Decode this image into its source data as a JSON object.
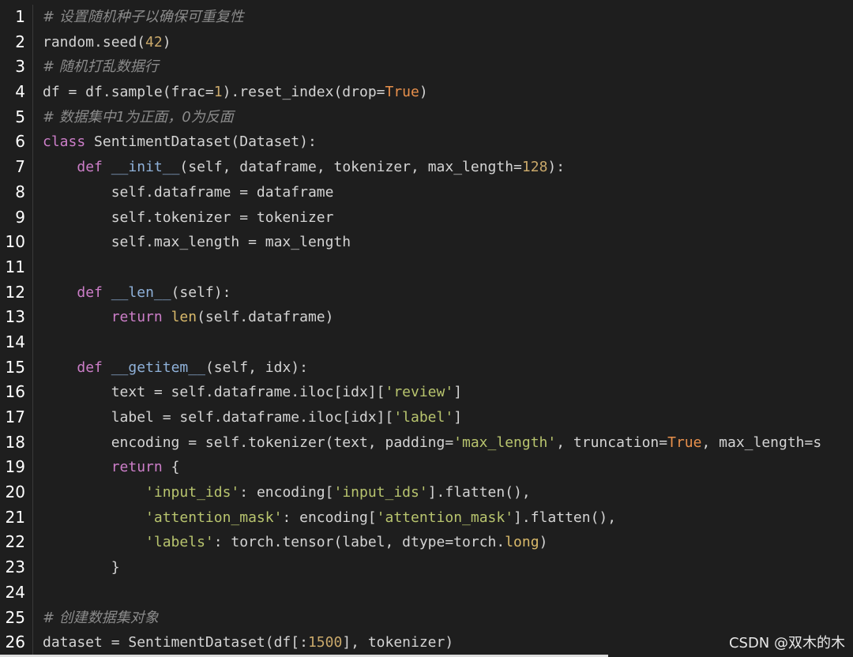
{
  "editor": {
    "lines": [
      {
        "n": "1",
        "tokens": [
          {
            "t": "# 设置随机种子以确保可重复性",
            "c": "comment"
          }
        ]
      },
      {
        "n": "2",
        "tokens": [
          {
            "t": "random.seed(",
            "c": "plain"
          },
          {
            "t": "42",
            "c": "number"
          },
          {
            "t": ")",
            "c": "plain"
          }
        ]
      },
      {
        "n": "3",
        "tokens": [
          {
            "t": "# 随机打乱数据行",
            "c": "comment"
          }
        ]
      },
      {
        "n": "4",
        "tokens": [
          {
            "t": "df = df.sample(frac=",
            "c": "plain"
          },
          {
            "t": "1",
            "c": "number"
          },
          {
            "t": ").reset_index(drop=",
            "c": "plain"
          },
          {
            "t": "True",
            "c": "bool"
          },
          {
            "t": ")",
            "c": "plain"
          }
        ]
      },
      {
        "n": "5",
        "tokens": [
          {
            "t": "# 数据集中1为正面，0为反面",
            "c": "comment"
          }
        ]
      },
      {
        "n": "6",
        "tokens": [
          {
            "t": "class",
            "c": "keyword"
          },
          {
            "t": " SentimentDataset(Dataset):",
            "c": "plain"
          }
        ]
      },
      {
        "n": "7",
        "tokens": [
          {
            "t": "    ",
            "c": "plain"
          },
          {
            "t": "def",
            "c": "keyword"
          },
          {
            "t": " ",
            "c": "plain"
          },
          {
            "t": "__init__",
            "c": "dunder"
          },
          {
            "t": "(self, dataframe, tokenizer, max_length=",
            "c": "plain"
          },
          {
            "t": "128",
            "c": "number"
          },
          {
            "t": "):",
            "c": "plain"
          }
        ]
      },
      {
        "n": "8",
        "tokens": [
          {
            "t": "        self.dataframe = dataframe",
            "c": "plain"
          }
        ]
      },
      {
        "n": "9",
        "tokens": [
          {
            "t": "        self.tokenizer = tokenizer",
            "c": "plain"
          }
        ]
      },
      {
        "n": "10",
        "tokens": [
          {
            "t": "        self.max_length = max_length",
            "c": "plain"
          }
        ]
      },
      {
        "n": "11",
        "tokens": []
      },
      {
        "n": "12",
        "tokens": [
          {
            "t": "    ",
            "c": "plain"
          },
          {
            "t": "def",
            "c": "keyword"
          },
          {
            "t": " ",
            "c": "plain"
          },
          {
            "t": "__len__",
            "c": "dunder"
          },
          {
            "t": "(self):",
            "c": "plain"
          }
        ]
      },
      {
        "n": "13",
        "tokens": [
          {
            "t": "        ",
            "c": "plain"
          },
          {
            "t": "return",
            "c": "keyword"
          },
          {
            "t": " ",
            "c": "plain"
          },
          {
            "t": "len",
            "c": "builtin"
          },
          {
            "t": "(self.dataframe)",
            "c": "plain"
          }
        ]
      },
      {
        "n": "14",
        "tokens": []
      },
      {
        "n": "15",
        "tokens": [
          {
            "t": "    ",
            "c": "plain"
          },
          {
            "t": "def",
            "c": "keyword"
          },
          {
            "t": " ",
            "c": "plain"
          },
          {
            "t": "__getitem__",
            "c": "dunder"
          },
          {
            "t": "(self, idx):",
            "c": "plain"
          }
        ]
      },
      {
        "n": "16",
        "tokens": [
          {
            "t": "        text = self.dataframe.iloc[idx][",
            "c": "plain"
          },
          {
            "t": "'review'",
            "c": "string"
          },
          {
            "t": "]",
            "c": "plain"
          }
        ]
      },
      {
        "n": "17",
        "tokens": [
          {
            "t": "        label = self.dataframe.iloc[idx][",
            "c": "plain"
          },
          {
            "t": "'label'",
            "c": "string"
          },
          {
            "t": "]",
            "c": "plain"
          }
        ]
      },
      {
        "n": "18",
        "tokens": [
          {
            "t": "        encoding = self.tokenizer(text, padding=",
            "c": "plain"
          },
          {
            "t": "'max_length'",
            "c": "string"
          },
          {
            "t": ", truncation=",
            "c": "plain"
          },
          {
            "t": "True",
            "c": "bool"
          },
          {
            "t": ", max_length=s",
            "c": "plain"
          }
        ]
      },
      {
        "n": "19",
        "tokens": [
          {
            "t": "        ",
            "c": "plain"
          },
          {
            "t": "return",
            "c": "keyword"
          },
          {
            "t": " {",
            "c": "plain"
          }
        ]
      },
      {
        "n": "20",
        "tokens": [
          {
            "t": "            ",
            "c": "plain"
          },
          {
            "t": "'input_ids'",
            "c": "string"
          },
          {
            "t": ": encoding[",
            "c": "plain"
          },
          {
            "t": "'input_ids'",
            "c": "string"
          },
          {
            "t": "].flatten(),",
            "c": "plain"
          }
        ]
      },
      {
        "n": "21",
        "tokens": [
          {
            "t": "            ",
            "c": "plain"
          },
          {
            "t": "'attention_mask'",
            "c": "string"
          },
          {
            "t": ": encoding[",
            "c": "plain"
          },
          {
            "t": "'attention_mask'",
            "c": "string"
          },
          {
            "t": "].flatten(),",
            "c": "plain"
          }
        ]
      },
      {
        "n": "22",
        "tokens": [
          {
            "t": "            ",
            "c": "plain"
          },
          {
            "t": "'labels'",
            "c": "string"
          },
          {
            "t": ": torch.tensor(label, dtype=torch.",
            "c": "plain"
          },
          {
            "t": "long",
            "c": "builtin"
          },
          {
            "t": ")",
            "c": "plain"
          }
        ]
      },
      {
        "n": "23",
        "tokens": [
          {
            "t": "        }",
            "c": "plain"
          }
        ]
      },
      {
        "n": "24",
        "tokens": []
      },
      {
        "n": "25",
        "tokens": [
          {
            "t": "# 创建数据集对象",
            "c": "comment"
          }
        ]
      },
      {
        "n": "26",
        "tokens": [
          {
            "t": "dataset = SentimentDataset(df[:",
            "c": "plain"
          },
          {
            "t": "1500",
            "c": "number"
          },
          {
            "t": "], tokenizer)",
            "c": "plain"
          }
        ]
      }
    ]
  },
  "watermark": "CSDN @双木的木",
  "colors": {
    "background": "#1e1e1e",
    "comment": "#8b8b8b",
    "keyword": "#cc7ec8",
    "number": "#c9a86a",
    "string": "#b8c46e",
    "bool": "#e8904c",
    "builtin": "#d9b96a",
    "dunder": "#8fb1d9",
    "plain": "#d4d4d4"
  }
}
